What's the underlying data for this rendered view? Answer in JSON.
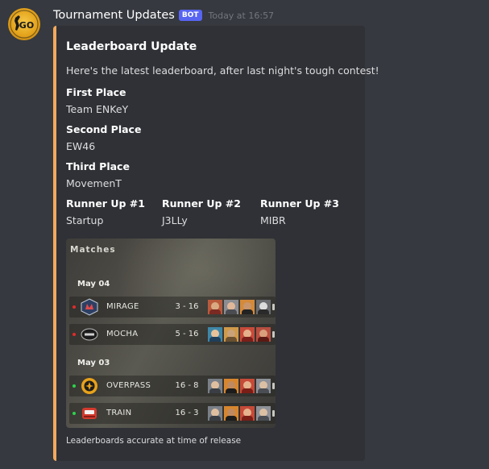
{
  "message": {
    "author": "Tournament Updates",
    "bot_tag": "BOT",
    "timestamp": "Today at 16:57",
    "avatar_icon": "cs-go-logo-icon",
    "avatar_text": "GO"
  },
  "embed": {
    "accent_color": "#f2a95e",
    "title": "Leaderboard Update",
    "description": "Here's the latest leaderboard, after last night's tough contest!",
    "fields": [
      {
        "name": "First Place",
        "value": "Team ENKeY"
      },
      {
        "name": "Second Place",
        "value": "EW46"
      },
      {
        "name": "Third Place",
        "value": "MovemenT"
      },
      {
        "name": "Runner Up #1",
        "value": "Startup"
      },
      {
        "name": "Runner Up #2",
        "value": "J3LLy"
      },
      {
        "name": "Runner Up #3",
        "value": "MIBR"
      }
    ],
    "image": {
      "title": "Matches",
      "groups": [
        {
          "date": "May 04",
          "matches": [
            {
              "map": "MIRAGE",
              "score": "3 - 16",
              "result": "loss",
              "status_color": "#e02b2b",
              "map_icon": "mirage-map-icon"
            },
            {
              "map": "MOCHA",
              "score": "5 - 16",
              "result": "loss",
              "status_color": "#e02b2b",
              "map_icon": "mocha-map-icon"
            }
          ]
        },
        {
          "date": "May 03",
          "matches": [
            {
              "map": "OVERPASS",
              "score": "16 - 8",
              "result": "win",
              "status_color": "#2bd44a",
              "map_icon": "overpass-map-icon"
            },
            {
              "map": "TRAIN",
              "score": "16 - 3",
              "result": "win",
              "status_color": "#2bd44a",
              "map_icon": "train-map-icon"
            }
          ]
        }
      ]
    },
    "footer": "Leaderboards accurate at time of release"
  }
}
